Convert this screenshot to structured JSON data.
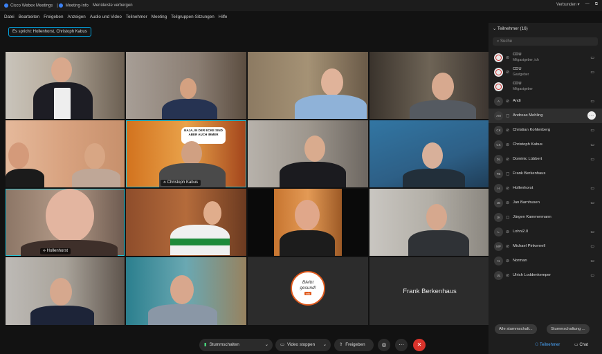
{
  "titlebar": {
    "app": "Cisco Webex Meetings",
    "meeting_info": "Meeting-Info",
    "window_menu": "Menüleiste verbergen",
    "status": "Verbunden ▾",
    "minimize": "—",
    "restore": "⧉"
  },
  "menubar": [
    "Datei",
    "Bearbeiten",
    "Freigeben",
    "Anzeigen",
    "Audio und Video",
    "Teilnehmer",
    "Meeting",
    "Teilgruppen-Sitzungen",
    "Hilfe"
  ],
  "speaking": "Es spricht: Hollenhorst, Christoph Kabus",
  "tiles": {
    "t6_name": "Christoph Kabus",
    "t9_name": "Hollenhorst",
    "t6_sign": "NAJA, IN DER ECKE SIND ABER AUCH IMMER",
    "t15_logo_line1": "Bleibt",
    "t15_logo_line2": "gesund!",
    "t15_logo_brand": "cdu",
    "t16_name": "Frank Berkenhaus"
  },
  "panel": {
    "title": "Teilnehmer (16)",
    "search_placeholder": "Suche",
    "participants": [
      {
        "initials": "",
        "name": "CDU",
        "sub": "Mitgastgeber, ich",
        "logo": true
      },
      {
        "initials": "",
        "name": "CDU",
        "sub": "Gastgeber",
        "logo": true
      },
      {
        "initials": "",
        "name": "CDU",
        "sub": "Mitgastgeber",
        "logo": true
      },
      {
        "initials": "A",
        "name": "Andi",
        "sub": ""
      },
      {
        "initials": "AM",
        "name": "Andreas Mehling",
        "sub": ""
      },
      {
        "initials": "CK",
        "name": "Christian Kohlenberg",
        "sub": ""
      },
      {
        "initials": "CK",
        "name": "Christoph Kabus",
        "sub": ""
      },
      {
        "initials": "DL",
        "name": "Dominic Lübbert",
        "sub": ""
      },
      {
        "initials": "FB",
        "name": "Frank Berkenhaus",
        "sub": ""
      },
      {
        "initials": "H",
        "name": "Hollenhorst",
        "sub": ""
      },
      {
        "initials": "JB",
        "name": "Jan Barnhusen",
        "sub": ""
      },
      {
        "initials": "JK",
        "name": "Jürgen Kammermann",
        "sub": ""
      },
      {
        "initials": "L",
        "name": "Lohni2.0",
        "sub": ""
      },
      {
        "initials": "MP",
        "name": "Michael Pinkernell",
        "sub": ""
      },
      {
        "initials": "N",
        "name": "Norman",
        "sub": ""
      },
      {
        "initials": "UL",
        "name": "Ulrich Loddenkemper",
        "sub": ""
      }
    ],
    "mute_all": "Alle stummschalt...",
    "unmute": "Stummschaltung ..."
  },
  "controls": {
    "mute": "Stummschalten",
    "video": "Video stoppen",
    "share": "Freigeben",
    "participants": "Teilnehmer",
    "chat": "Chat"
  }
}
